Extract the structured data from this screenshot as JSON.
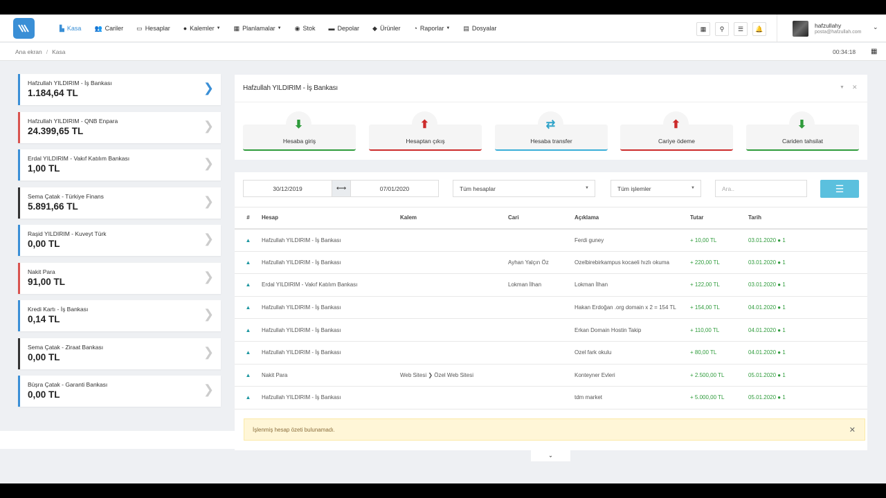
{
  "nav": [
    {
      "label": "Kasa",
      "icon": "▙",
      "active": true
    },
    {
      "label": "Cariler",
      "icon": "👥"
    },
    {
      "label": "Hesaplar",
      "icon": "▭"
    },
    {
      "label": "Kalemler",
      "icon": "●",
      "caret": true
    },
    {
      "label": "Planlamalar",
      "icon": "▦",
      "caret": true
    },
    {
      "label": "Stok",
      "icon": "◉"
    },
    {
      "label": "Depolar",
      "icon": "▬"
    },
    {
      "label": "Ürünler",
      "icon": "◆"
    },
    {
      "label": "Raporlar",
      "icon": "◔",
      "caret": true
    },
    {
      "label": "Dosyalar",
      "icon": "▤"
    }
  ],
  "user": {
    "name": "hafzullahy",
    "email": "posta@hafzullah.com"
  },
  "breadcrumb": {
    "home": "Ana ekran",
    "current": "Kasa"
  },
  "clock": "00:34:18",
  "accounts": [
    {
      "name": "Hafzullah YILDIRIM - İş Bankası",
      "balance": "1.184,64 TL",
      "color": "blue",
      "selected": true
    },
    {
      "name": "Hafzullah YILDIRIM - QNB Enpara",
      "balance": "24.399,65 TL",
      "color": "red"
    },
    {
      "name": "Erdal YILDIRIM - Vakıf Katılım Bankası",
      "balance": "1,00 TL",
      "color": "blue"
    },
    {
      "name": "Sema Çatak - Türkiye Finans",
      "balance": "5.891,66 TL",
      "color": "dark"
    },
    {
      "name": "Raşid YILDIRIM - Kuveyt Türk",
      "balance": "0,00 TL",
      "color": "blue"
    },
    {
      "name": "Nakit Para",
      "balance": "91,00 TL",
      "color": "red"
    },
    {
      "name": "Kredi Kartı - İş Bankası",
      "balance": "0,14 TL",
      "color": "blue"
    },
    {
      "name": "Sema Çatak - Ziraat Bankası",
      "balance": "0,00 TL",
      "color": "dark"
    },
    {
      "name": "Büşra Çatak - Garanti Bankası",
      "balance": "0,00 TL",
      "color": "blue"
    }
  ],
  "panel": {
    "title": "Hafzullah YILDIRIM - İş Bankası"
  },
  "actions": [
    {
      "label": "Hesaba giriş",
      "icon": "⬇",
      "color": "green"
    },
    {
      "label": "Hesaptan çıkış",
      "icon": "⬆",
      "color": "red"
    },
    {
      "label": "Hesaba transfer",
      "icon": "⇄",
      "color": "blue"
    },
    {
      "label": "Cariye ödeme",
      "icon": "⬆",
      "color": "red"
    },
    {
      "label": "Cariden tahsilat",
      "icon": "⬇",
      "color": "green"
    }
  ],
  "filters": {
    "date_from": "30/12/2019",
    "date_to": "07/01/2020",
    "account_select": "Tüm hesaplar",
    "type_select": "Tüm işlemler",
    "search_placeholder": "Ara.."
  },
  "table": {
    "headers": [
      "#",
      "Hesap",
      "Kalem",
      "Cari",
      "Açıklama",
      "Tutar",
      "Tarih"
    ],
    "rows": [
      {
        "hesap": "Hafzullah YILDIRIM - İş Bankası",
        "kalem": "",
        "cari": "",
        "aciklama": "Ferdi guney",
        "tutar": "+ 10,00 TL",
        "tarih": "03.01.2020",
        "count": "1"
      },
      {
        "hesap": "Hafzullah YILDIRIM - İş Bankası",
        "kalem": "",
        "cari": "Ayhan Yalçın Öz",
        "aciklama": "Ozelbirebirkampus kocaeli hızlı okuma",
        "tutar": "+ 220,00 TL",
        "tarih": "03.01.2020",
        "count": "1"
      },
      {
        "hesap": "Erdal YILDIRIM - Vakıf Katılım Bankası",
        "kalem": "",
        "cari": "Lokman İlhan",
        "aciklama": "Lokman İlhan",
        "tutar": "+ 122,00 TL",
        "tarih": "03.01.2020",
        "count": "1"
      },
      {
        "hesap": "Hafzullah YILDIRIM - İş Bankası",
        "kalem": "",
        "cari": "",
        "aciklama": "Hakan Erdoğan .org domain x 2 = 154 TL",
        "tutar": "+ 154,00 TL",
        "tarih": "04.01.2020",
        "count": "1"
      },
      {
        "hesap": "Hafzullah YILDIRIM - İş Bankası",
        "kalem": "",
        "cari": "",
        "aciklama": "Erkan Domain Hostin Takip",
        "tutar": "+ 110,00 TL",
        "tarih": "04.01.2020",
        "count": "1"
      },
      {
        "hesap": "Hafzullah YILDIRIM - İş Bankası",
        "kalem": "",
        "cari": "",
        "aciklama": "Ozel fark okulu",
        "tutar": "+ 80,00 TL",
        "tarih": "04.01.2020",
        "count": "1"
      },
      {
        "hesap": "Nakit Para",
        "kalem": "Web Sitesi ❯ Özel Web Sitesi",
        "cari": "",
        "aciklama": "Konteyner Evleri",
        "tutar": "+ 2.500,00 TL",
        "tarih": "05.01.2020",
        "count": "1"
      },
      {
        "hesap": "Hafzullah YILDIRIM - İş Bankası",
        "kalem": "",
        "cari": "",
        "aciklama": "tdm market",
        "tutar": "+ 5.000,00 TL",
        "tarih": "05.01.2020",
        "count": "1"
      }
    ]
  },
  "alert": {
    "text": "İşlenmiş hesap özeti bulunamadı."
  },
  "colors": {
    "accent": "#3a8fd6",
    "green": "#2e9b3b",
    "red": "#cc2b2b",
    "cyan": "#5bc0de"
  }
}
